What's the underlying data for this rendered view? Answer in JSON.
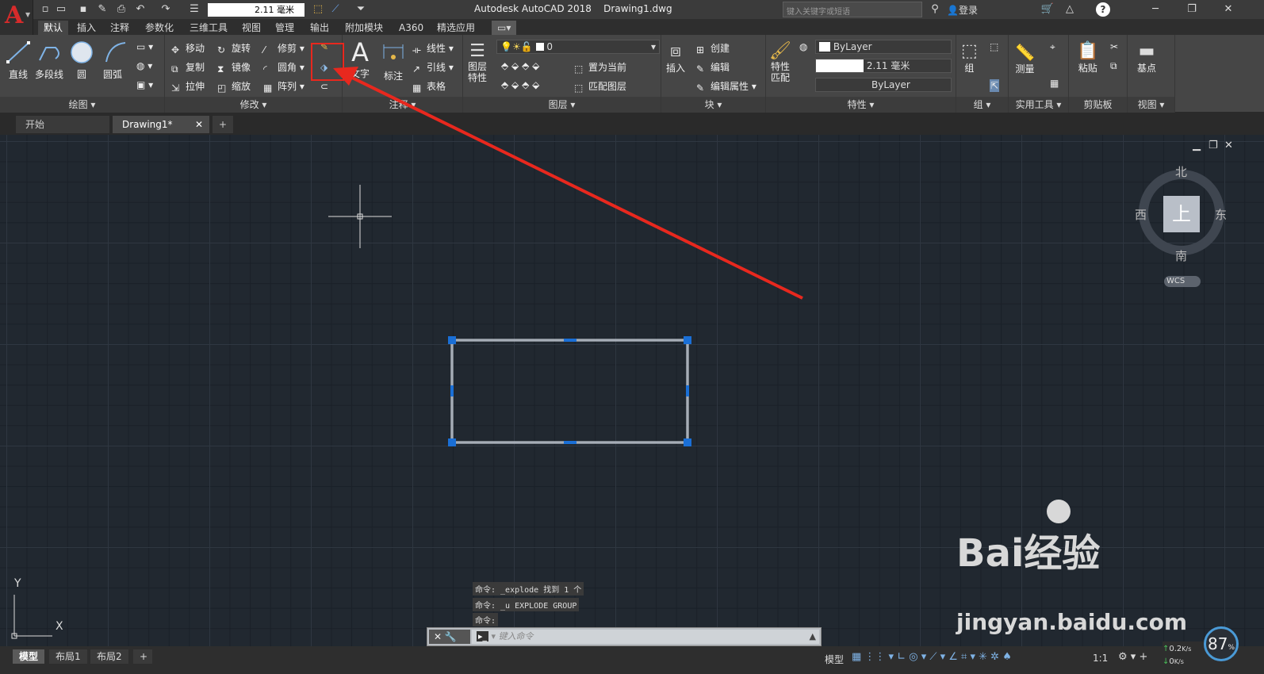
{
  "window": {
    "title": "Autodesk AutoCAD 2018    Drawing1.dwg",
    "search_placeholder": "键入关键字或短语",
    "login": "登录",
    "help": "?"
  },
  "quick_access": {
    "lineweight_value": "2.11 毫米"
  },
  "ribbon_tabs": [
    "默认",
    "插入",
    "注释",
    "参数化",
    "三维工具",
    "视图",
    "管理",
    "输出",
    "附加模块",
    "A360",
    "精选应用"
  ],
  "panels": {
    "draw": {
      "title": "绘图",
      "tools": [
        "直线",
        "多段线",
        "圆",
        "圆弧"
      ]
    },
    "modify": {
      "title": "修改",
      "tools": [
        "移动",
        "旋转",
        "修剪",
        "复制",
        "镜像",
        "圆角",
        "拉伸",
        "缩放",
        "阵列"
      ]
    },
    "annotation": {
      "title": "注释",
      "tools": [
        "文字",
        "标注",
        "线性",
        "引线",
        "表格"
      ]
    },
    "layers": {
      "title": "图层",
      "props_label": "图层\n特性",
      "current_layer": "0",
      "set_current": "置为当前",
      "match_layer": "匹配图层"
    },
    "block": {
      "title": "块",
      "insert": "插入",
      "create": "创建",
      "edit": "编辑",
      "edit_attr": "编辑属性"
    },
    "properties": {
      "title": "特性",
      "match": "特性\n匹配",
      "color": "ByLayer",
      "lineweight": "2.11 毫米",
      "linetype": "ByLayer"
    },
    "groups": {
      "title": "组",
      "group": "组"
    },
    "utilities": {
      "title": "实用工具",
      "measure": "测量"
    },
    "clipboard": {
      "title": "剪贴板",
      "paste": "粘贴"
    },
    "view": {
      "title": "视图",
      "base": "基点"
    }
  },
  "doc_tabs": [
    "开始",
    "Drawing1*"
  ],
  "viewcube": {
    "north": "北",
    "south": "南",
    "east": "东",
    "west": "西",
    "top": "上",
    "wcs": "WCS"
  },
  "ucs": {
    "x": "X",
    "y": "Y"
  },
  "command_history": [
    "命令: _explode 找到 1 个",
    "命令: _u EXPLODE GROUP",
    "命令:"
  ],
  "command_placeholder": "键入命令",
  "layout_tabs": [
    "模型",
    "布局1",
    "布局2"
  ],
  "status": {
    "model": "模型",
    "scale": "1:1",
    "net_up": "0.2",
    "net_down": "0",
    "net_unit": "K/s",
    "gauge": "87",
    "gauge_unit": "%"
  },
  "watermark": {
    "brand": "Bai经验",
    "url": "jingyan.baidu.com"
  },
  "colors": {
    "highlight": "#e8281e",
    "grip": "#1a6fd6",
    "canvas": "#212830",
    "accent_logo": "#d72b2b"
  }
}
